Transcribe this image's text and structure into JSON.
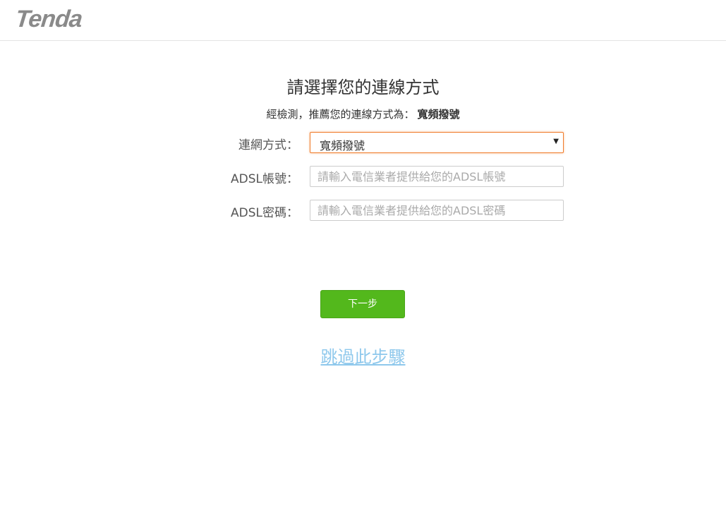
{
  "header": {
    "logo_text": "Tenda"
  },
  "main": {
    "title": "請選擇您的連線方式",
    "subtitle_prefix": "經檢測，推薦您的連線方式為：",
    "subtitle_recommend": "寬頻撥號"
  },
  "form": {
    "connection_type": {
      "label": "連網方式：",
      "selected": "寬頻撥號"
    },
    "adsl_account": {
      "label": "ADSL帳號：",
      "value": "",
      "placeholder": "請輸入電信業者提供給您的ADSL帳號"
    },
    "adsl_password": {
      "label": "ADSL密碼：",
      "value": "",
      "placeholder": "請輸入電信業者提供給您的ADSL密碼"
    }
  },
  "actions": {
    "next_label": "下一步",
    "skip_label": "跳過此步驟"
  },
  "colors": {
    "accent_green": "#53b81c",
    "focus_orange": "#f07c2a",
    "link_blue": "#8ec8ec"
  }
}
